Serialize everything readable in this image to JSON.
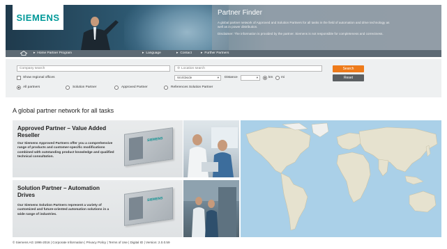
{
  "brand": {
    "logo": "SIEMENS"
  },
  "header": {
    "title": "Partner Finder",
    "description": "A global partner network of Approved and Solution Partners for all tasks in the field of automation and drive technology as well as in power distribution.",
    "disclaimer": "Disclaimer: The information is provided by the partner. Siemens is not responsible for completeness and correctness."
  },
  "nav": {
    "items": [
      {
        "label": "Home Partner Program"
      },
      {
        "label": "Language"
      },
      {
        "label": "Contact"
      },
      {
        "label": "Further Partners"
      }
    ]
  },
  "search": {
    "company_placeholder": "Company search",
    "location_placeholder": "Location search",
    "show_regional_label": "Show regional offices",
    "region_value": "Worldwide",
    "distance_label": "Distance",
    "distance_value": "",
    "unit_km": "km",
    "unit_mi": "mi",
    "search_button": "Search",
    "reset_button": "Reset",
    "filters": [
      {
        "label": "All partners",
        "selected": true
      },
      {
        "label": "Solution Partner",
        "selected": false
      },
      {
        "label": "Approved Partner",
        "selected": false
      },
      {
        "label": "References Solution Partner",
        "selected": false
      }
    ]
  },
  "main": {
    "headline": "A global partner network for all tasks",
    "tiles": [
      {
        "title": "Approved Partner – Value Added Reseller",
        "body": "Our Siemens Approved Partners offer you a comprehensive range of products and customer-specific modifications combined with outstanding product knowledge and qualified technical consultation.",
        "cert_logo": "SIEMENS"
      },
      {
        "title": "Solution Partner – Automation Drives",
        "body": "Our Siemens Solution Partners represent a variety of customized and future-oriented automation solutions in a wide range of industries.",
        "cert_logo": "SIEMENS"
      }
    ]
  },
  "footer": {
    "text": "© Siemens AG 1996-2016 | Corporate Information | Privacy Policy | Terms of Use | Digital ID | Version: 2.0.0.59"
  },
  "colors": {
    "brand_teal": "#009999",
    "search_orange": "#ee7b1b",
    "reset_gray": "#5b5f62",
    "nav_gray": "#5d6a74"
  }
}
